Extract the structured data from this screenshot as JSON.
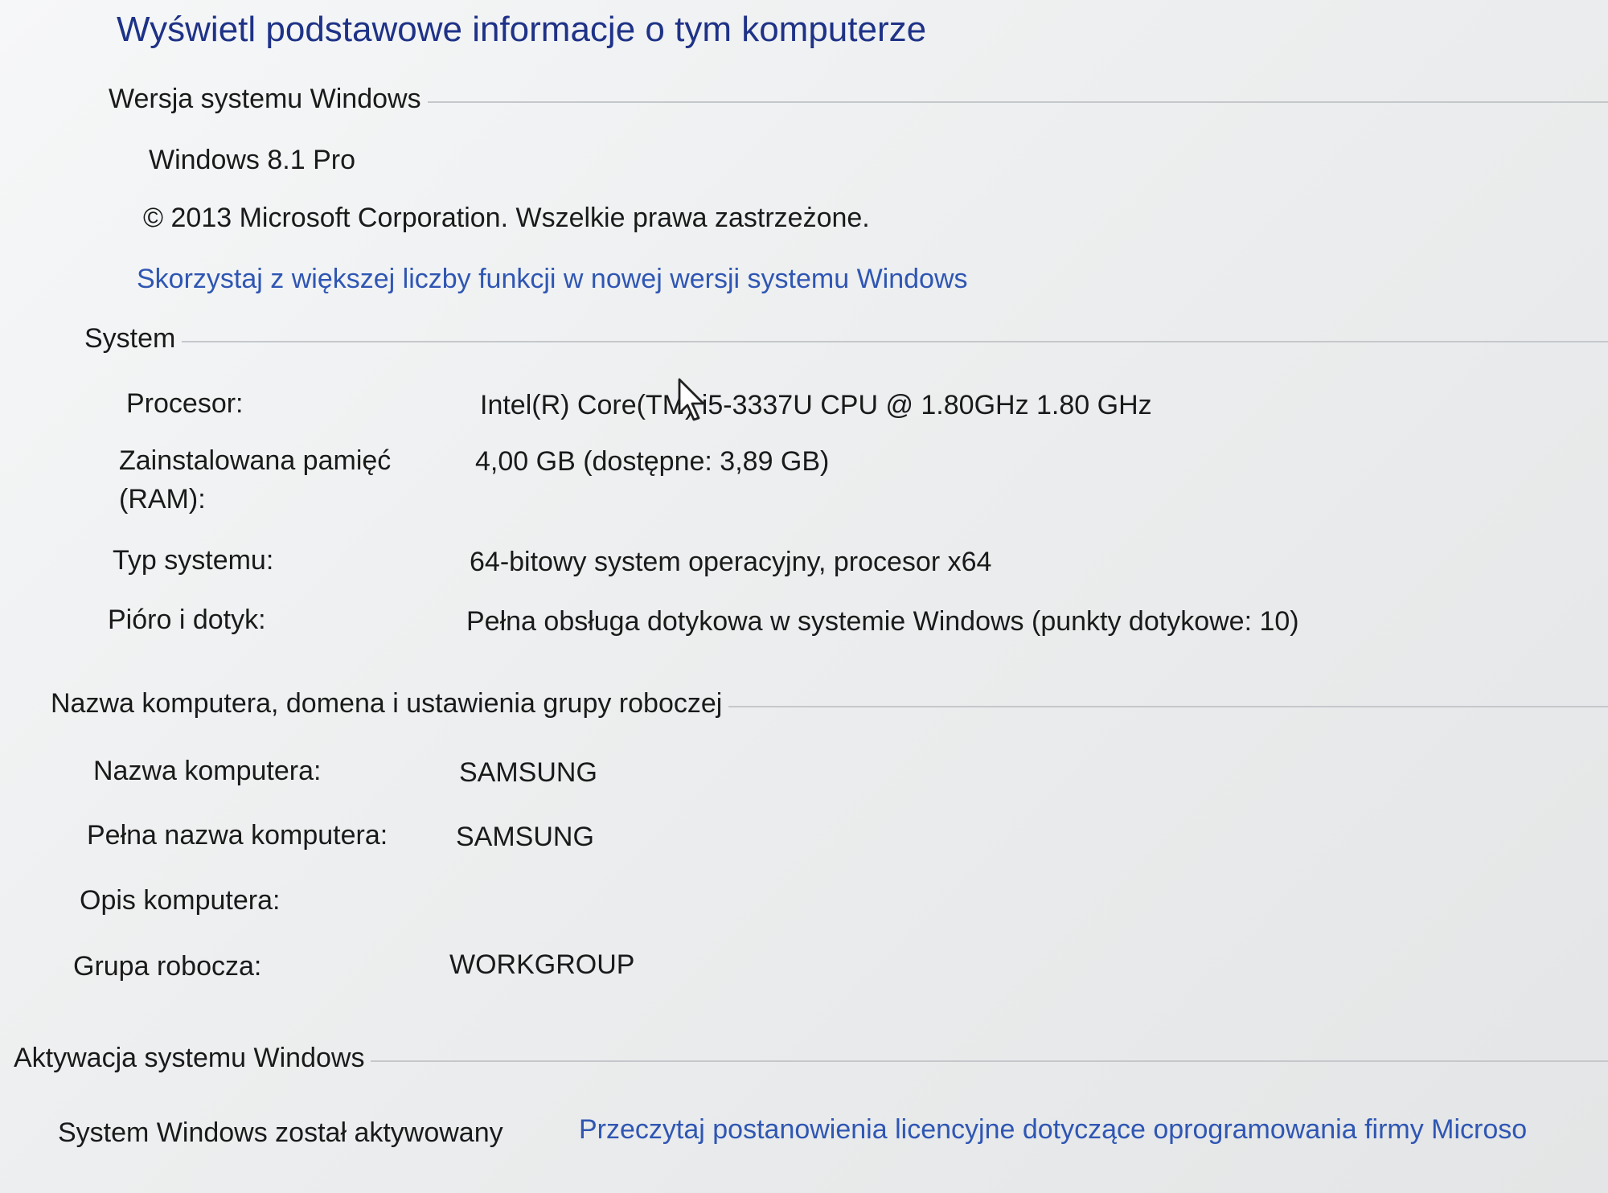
{
  "page": {
    "title": "Wyświetl podstawowe informacje o tym komputerze"
  },
  "windows_edition": {
    "heading": "Wersja systemu Windows",
    "edition": "Windows 8.1 Pro",
    "copyright": "© 2013 Microsoft Corporation. Wszelkie prawa zastrzeżone.",
    "upgrade_link": "Skorzystaj z większej liczby funkcji w nowej wersji systemu Windows"
  },
  "system": {
    "heading": "System",
    "rows": [
      {
        "label": "Procesor:",
        "value": "Intel(R) Core(TM) i5-3337U CPU @ 1.80GHz   1.80 GHz"
      },
      {
        "label": "Zainstalowana pamięć (RAM):",
        "value": "4,00 GB (dostępne: 3,89 GB)"
      },
      {
        "label": "Typ systemu:",
        "value": "64-bitowy system operacyjny, procesor x64"
      },
      {
        "label": "Pióro i dotyk:",
        "value": "Pełna obsługa dotykowa w systemie Windows (punkty dotykowe: 10)"
      }
    ]
  },
  "computer_name": {
    "heading": "Nazwa komputera, domena i ustawienia grupy roboczej",
    "rows": [
      {
        "label": "Nazwa komputera:",
        "value": "SAMSUNG"
      },
      {
        "label": "Pełna nazwa komputera:",
        "value": "SAMSUNG"
      },
      {
        "label": "Opis komputera:",
        "value": ""
      },
      {
        "label": "Grupa robocza:",
        "value": "WORKGROUP"
      }
    ]
  },
  "activation": {
    "heading": "Aktywacja systemu Windows",
    "status": "System Windows został aktywowany",
    "license_link": "Przeczytaj postanowienia licencyjne dotyczące oprogramowania firmy Microso"
  },
  "colors": {
    "title": "#1e3287",
    "link": "#2f56b3",
    "rule": "#c5c8cb"
  },
  "icons": {
    "cursor": "mouse-pointer-icon"
  }
}
